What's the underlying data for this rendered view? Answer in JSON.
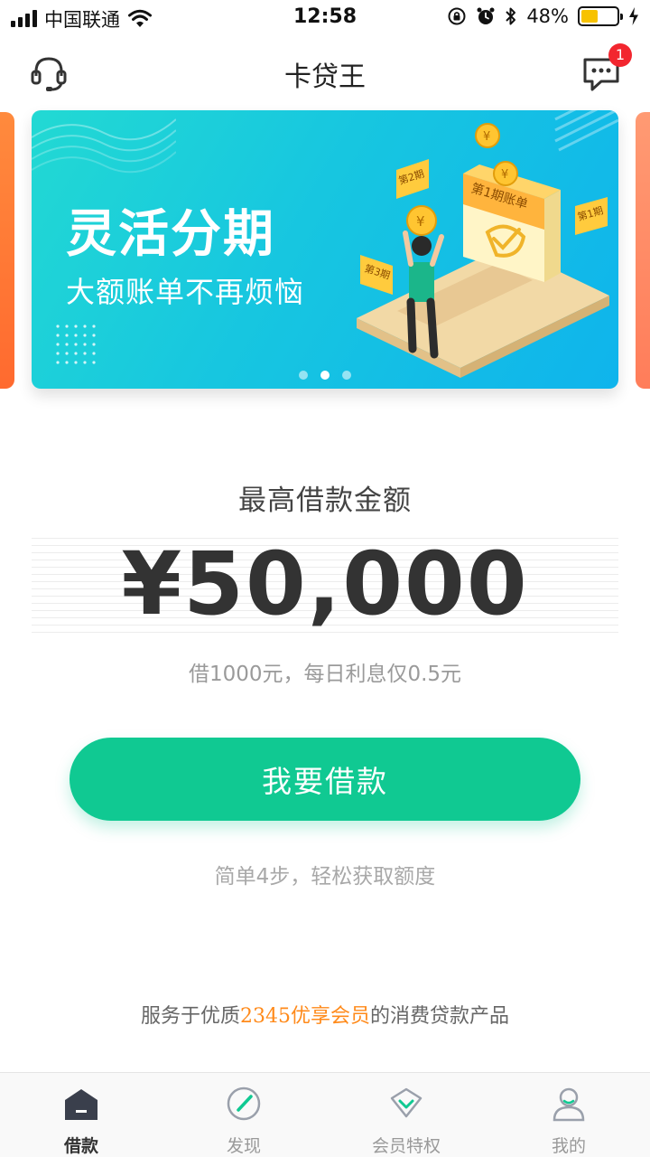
{
  "status_bar": {
    "carrier": "中国联通",
    "time": "12:58",
    "battery_percent": "48%",
    "battery_level": 0.48
  },
  "nav": {
    "title": "卡贷王",
    "message_badge": "1"
  },
  "banner": {
    "title": "灵活分期",
    "subtitle": "大额账单不再烦恼",
    "art_labels": [
      "第1期账单",
      "第2期",
      "第3期",
      "第1期"
    ],
    "active_slide": 2,
    "slide_count": 3
  },
  "loan": {
    "label": "最高借款金额",
    "amount": "¥50,000",
    "description": "借1000元，每日利息仅0.5元",
    "button_label": "我要借款",
    "hint": "简单4步，轻松获取额度"
  },
  "footer": {
    "service_prefix": "服务于优质",
    "service_brand": "2345优享会员",
    "service_suffix": "的消费贷款产品"
  },
  "tabs": [
    {
      "label": "借款",
      "icon": "home-icon",
      "active": true
    },
    {
      "label": "发现",
      "icon": "compass-icon",
      "active": false
    },
    {
      "label": "会员特权",
      "icon": "diamond-icon",
      "active": false
    },
    {
      "label": "我的",
      "icon": "user-icon",
      "active": false
    }
  ],
  "colors": {
    "primary": "#10c992",
    "banner_start": "#22d9d3",
    "banner_end": "#0fb4ec",
    "brand_orange": "#ff8a1a",
    "badge_red": "#f2262f"
  }
}
